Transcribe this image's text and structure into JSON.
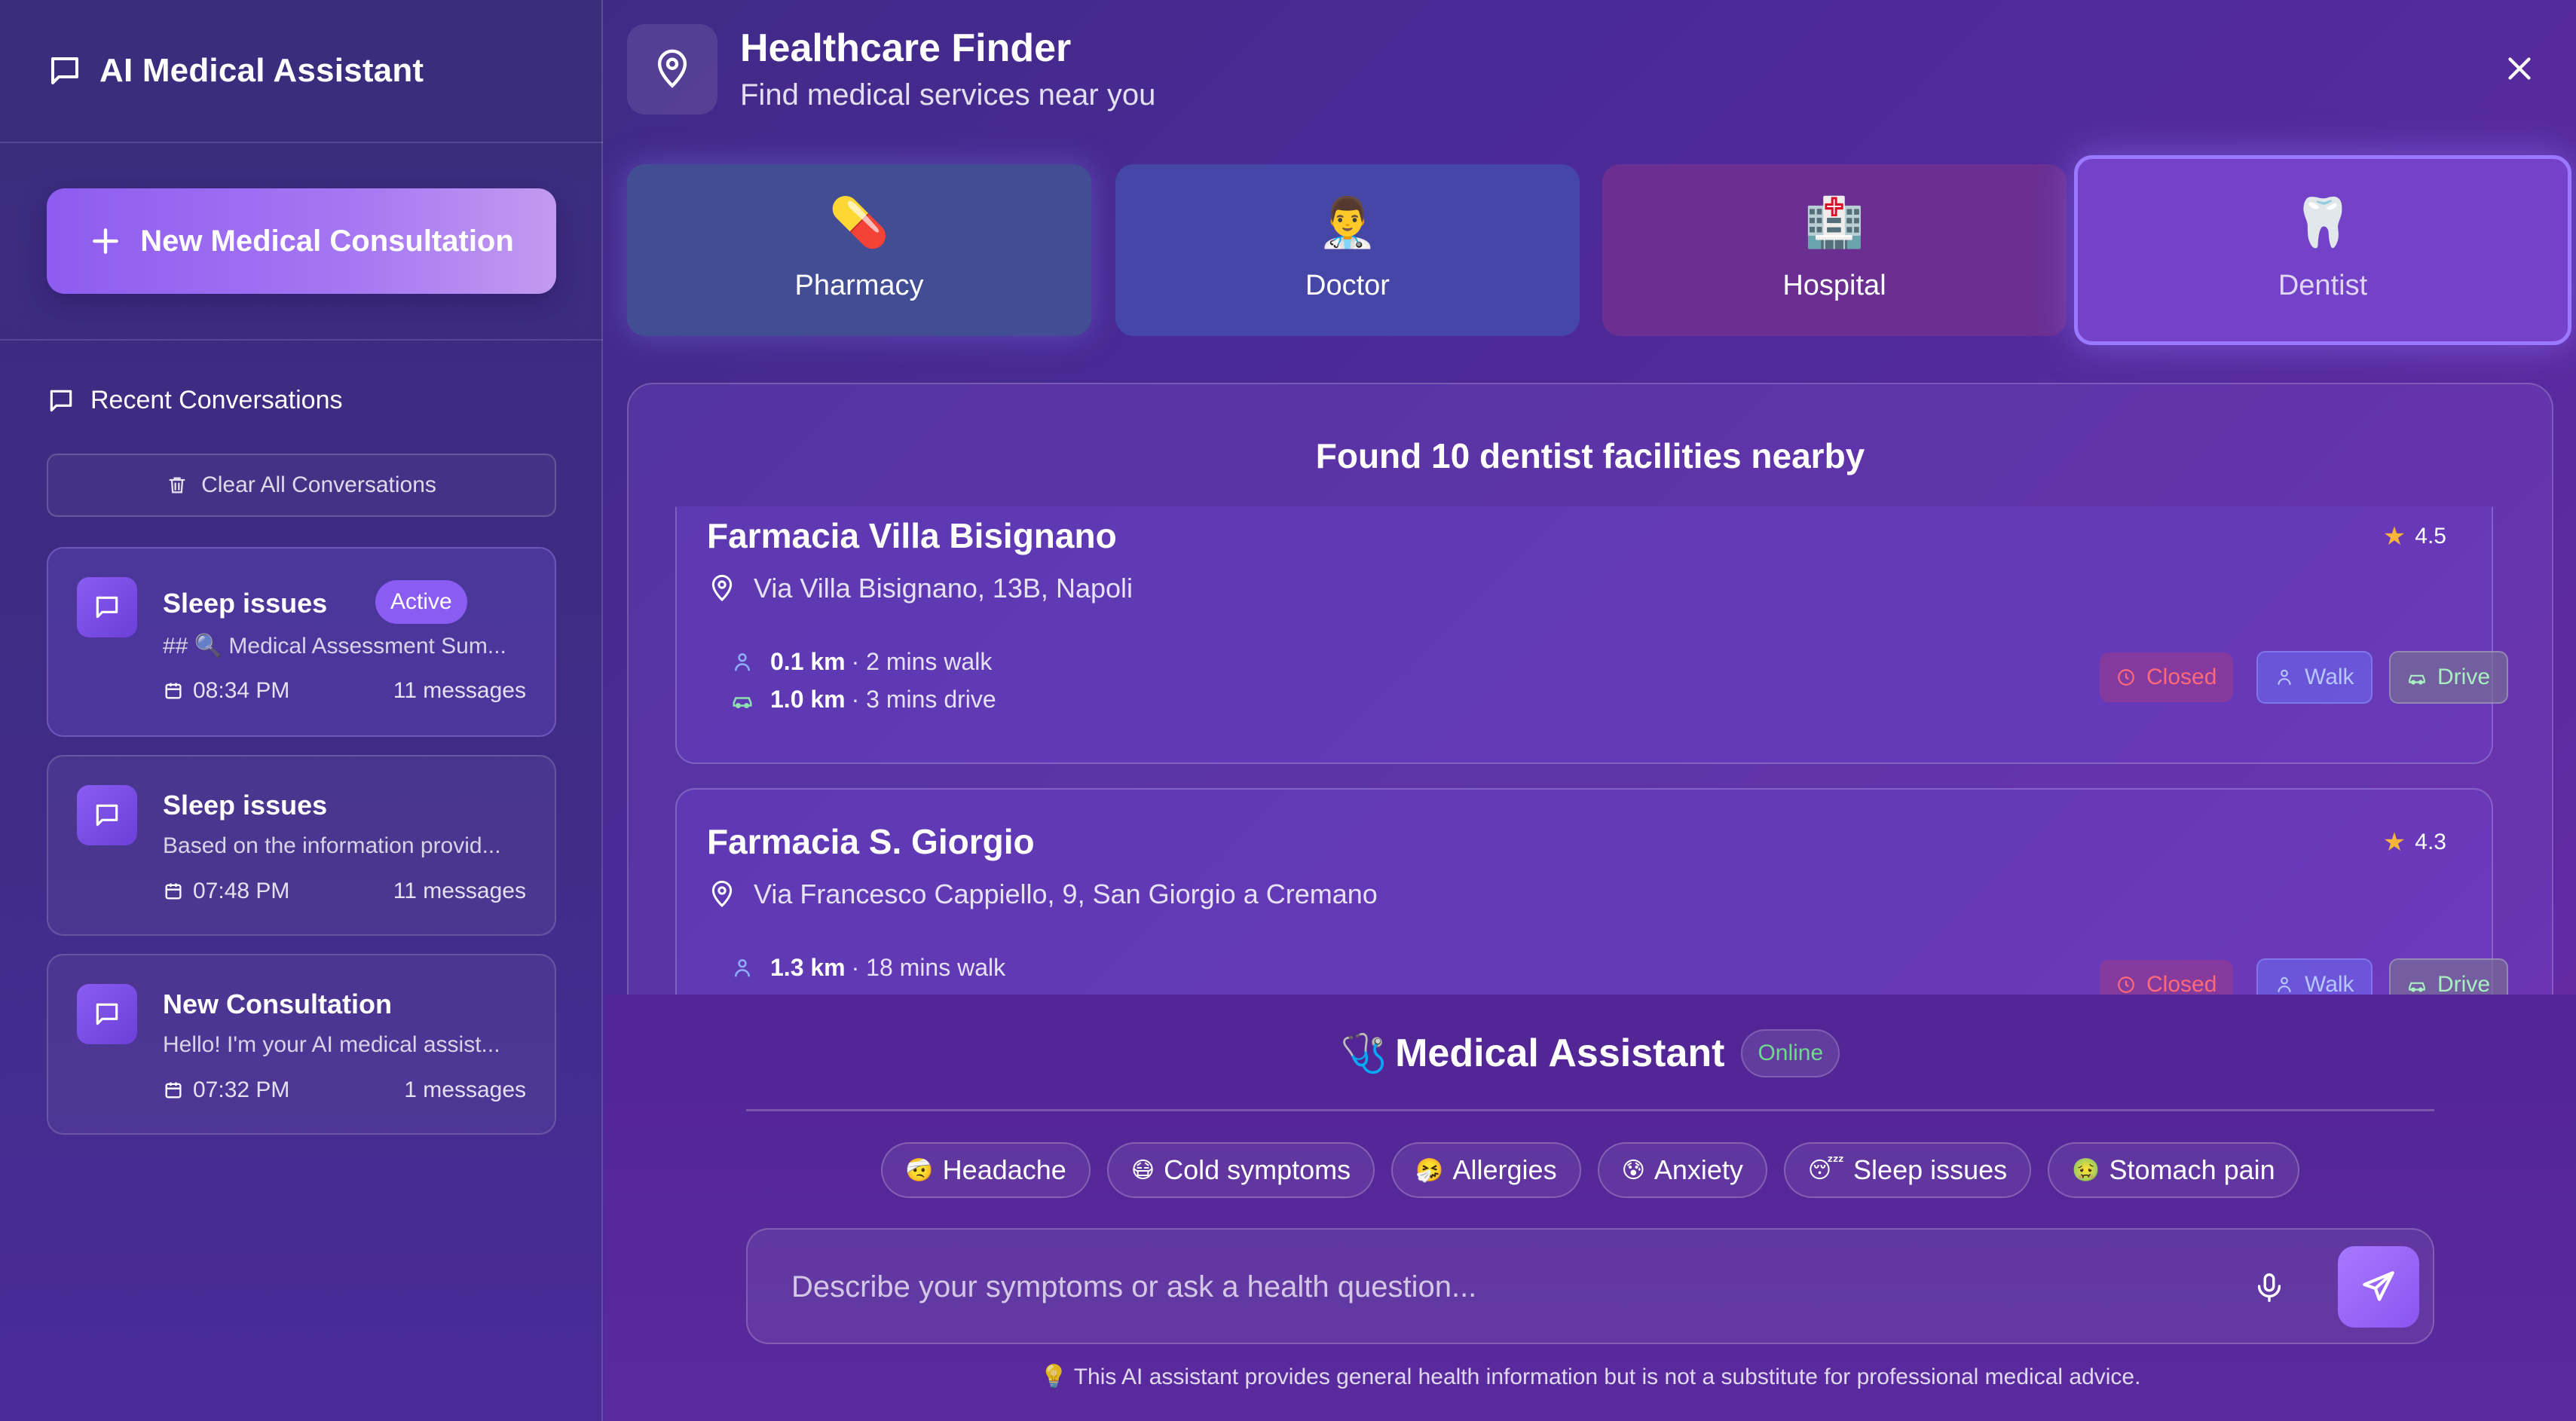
{
  "sidebar": {
    "title": "AI Medical Assistant",
    "new_button": "New Medical Consultation",
    "recent_heading": "Recent Conversations",
    "clear_button": "Clear All Conversations",
    "conversations": [
      {
        "title": "Sleep issues",
        "badge": "Active",
        "preview": "## 🔍 Medical Assessment Sum...",
        "time": "08:34 PM",
        "count": "11 messages"
      },
      {
        "title": "Sleep issues",
        "preview": "Based on the information provid...",
        "time": "07:48 PM",
        "count": "11 messages"
      },
      {
        "title": "New Consultation",
        "preview": "Hello! I'm your AI medical assist...",
        "time": "07:32 PM",
        "count": "1 messages"
      }
    ]
  },
  "header": {
    "title": "Healthcare Finder",
    "subtitle": "Find medical services near you"
  },
  "categories": [
    {
      "label": "Pharmacy",
      "icon": "💊"
    },
    {
      "label": "Doctor",
      "icon": "👨‍⚕️"
    },
    {
      "label": "Hospital",
      "icon": "🏥"
    },
    {
      "label": "Dentist",
      "icon": "🦷",
      "selected": true
    }
  ],
  "results": {
    "title": "Found 10 dentist facilities nearby",
    "facilities": [
      {
        "name": "Farmacia Villa Bisignano",
        "address": "Via Villa Bisignano, 13B, Napoli",
        "rating": "4.5",
        "walk_km": "0.1 km",
        "walk_time": "· 2 mins walk",
        "drive_km": "1.0 km",
        "drive_time": "· 3 mins drive",
        "status": "Closed",
        "walk_label": "Walk",
        "drive_label": "Drive"
      },
      {
        "name": "Farmacia S. Giorgio",
        "address": "Via Francesco Cappiello, 9, San Giorgio a Cremano",
        "rating": "4.3",
        "walk_km": "1.3 km",
        "walk_time": "· 18 mins walk",
        "status": "Closed",
        "walk_label": "Walk",
        "drive_label": "Drive"
      }
    ]
  },
  "assistant": {
    "icon": "🩺",
    "title": "Medical Assistant",
    "status": "Online",
    "quick_actions": [
      {
        "emoji": "🤕",
        "label": "Headache"
      },
      {
        "emoji": "😷",
        "label": "Cold symptoms"
      },
      {
        "emoji": "🤧",
        "label": "Allergies"
      },
      {
        "emoji": "😰",
        "label": "Anxiety"
      },
      {
        "emoji": "😴",
        "label": "Sleep issues"
      },
      {
        "emoji": "🤢",
        "label": "Stomach pain"
      }
    ],
    "input_placeholder": "Describe your symptoms or ask a health question...",
    "disclaimer_icon": "💡",
    "disclaimer": "This AI assistant provides general health information but is not a substitute for professional medical advice."
  },
  "colors": {
    "accent": "#8a5cf2",
    "closed": "#ff6a7a",
    "online": "#6fd98d",
    "star": "#f5b43a"
  }
}
